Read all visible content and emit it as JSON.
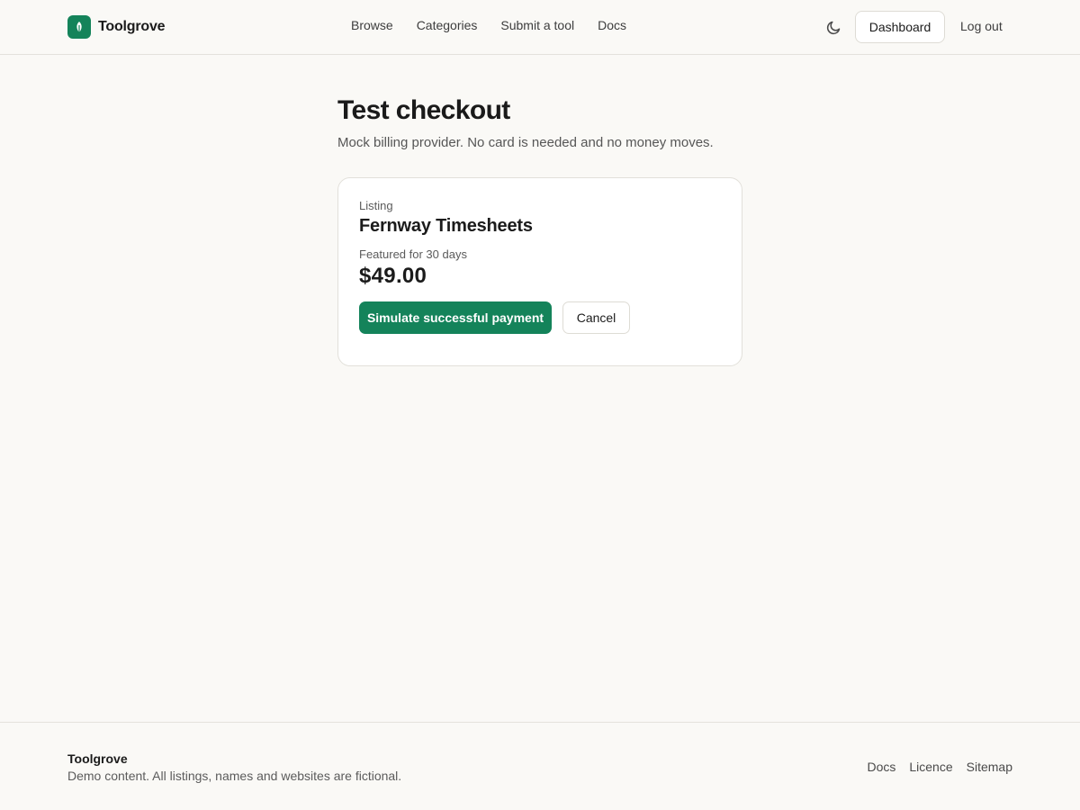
{
  "header": {
    "brand": "Toolgrove",
    "nav": [
      "Browse",
      "Categories",
      "Submit a tool",
      "Docs"
    ],
    "theme_toggle_icon": "moon-icon",
    "dashboard_label": "Dashboard",
    "logout_label": "Log out"
  },
  "main": {
    "title": "Test checkout",
    "subtitle": "Mock billing provider. No card is needed and no money moves.",
    "card": {
      "listing_label": "Listing",
      "listing_name": "Fernway Timesheets",
      "feature_label": "Featured for 30 days",
      "price": "$49.00",
      "pay_label": "Simulate successful payment",
      "cancel_label": "Cancel"
    }
  },
  "footer": {
    "brand": "Toolgrove",
    "note": "Demo content. All listings, names and websites are fictional.",
    "links": [
      "Docs",
      "Licence",
      "Sitemap"
    ]
  },
  "colors": {
    "accent": "#14835a",
    "background": "#faf9f6",
    "card": "#ffffff"
  }
}
